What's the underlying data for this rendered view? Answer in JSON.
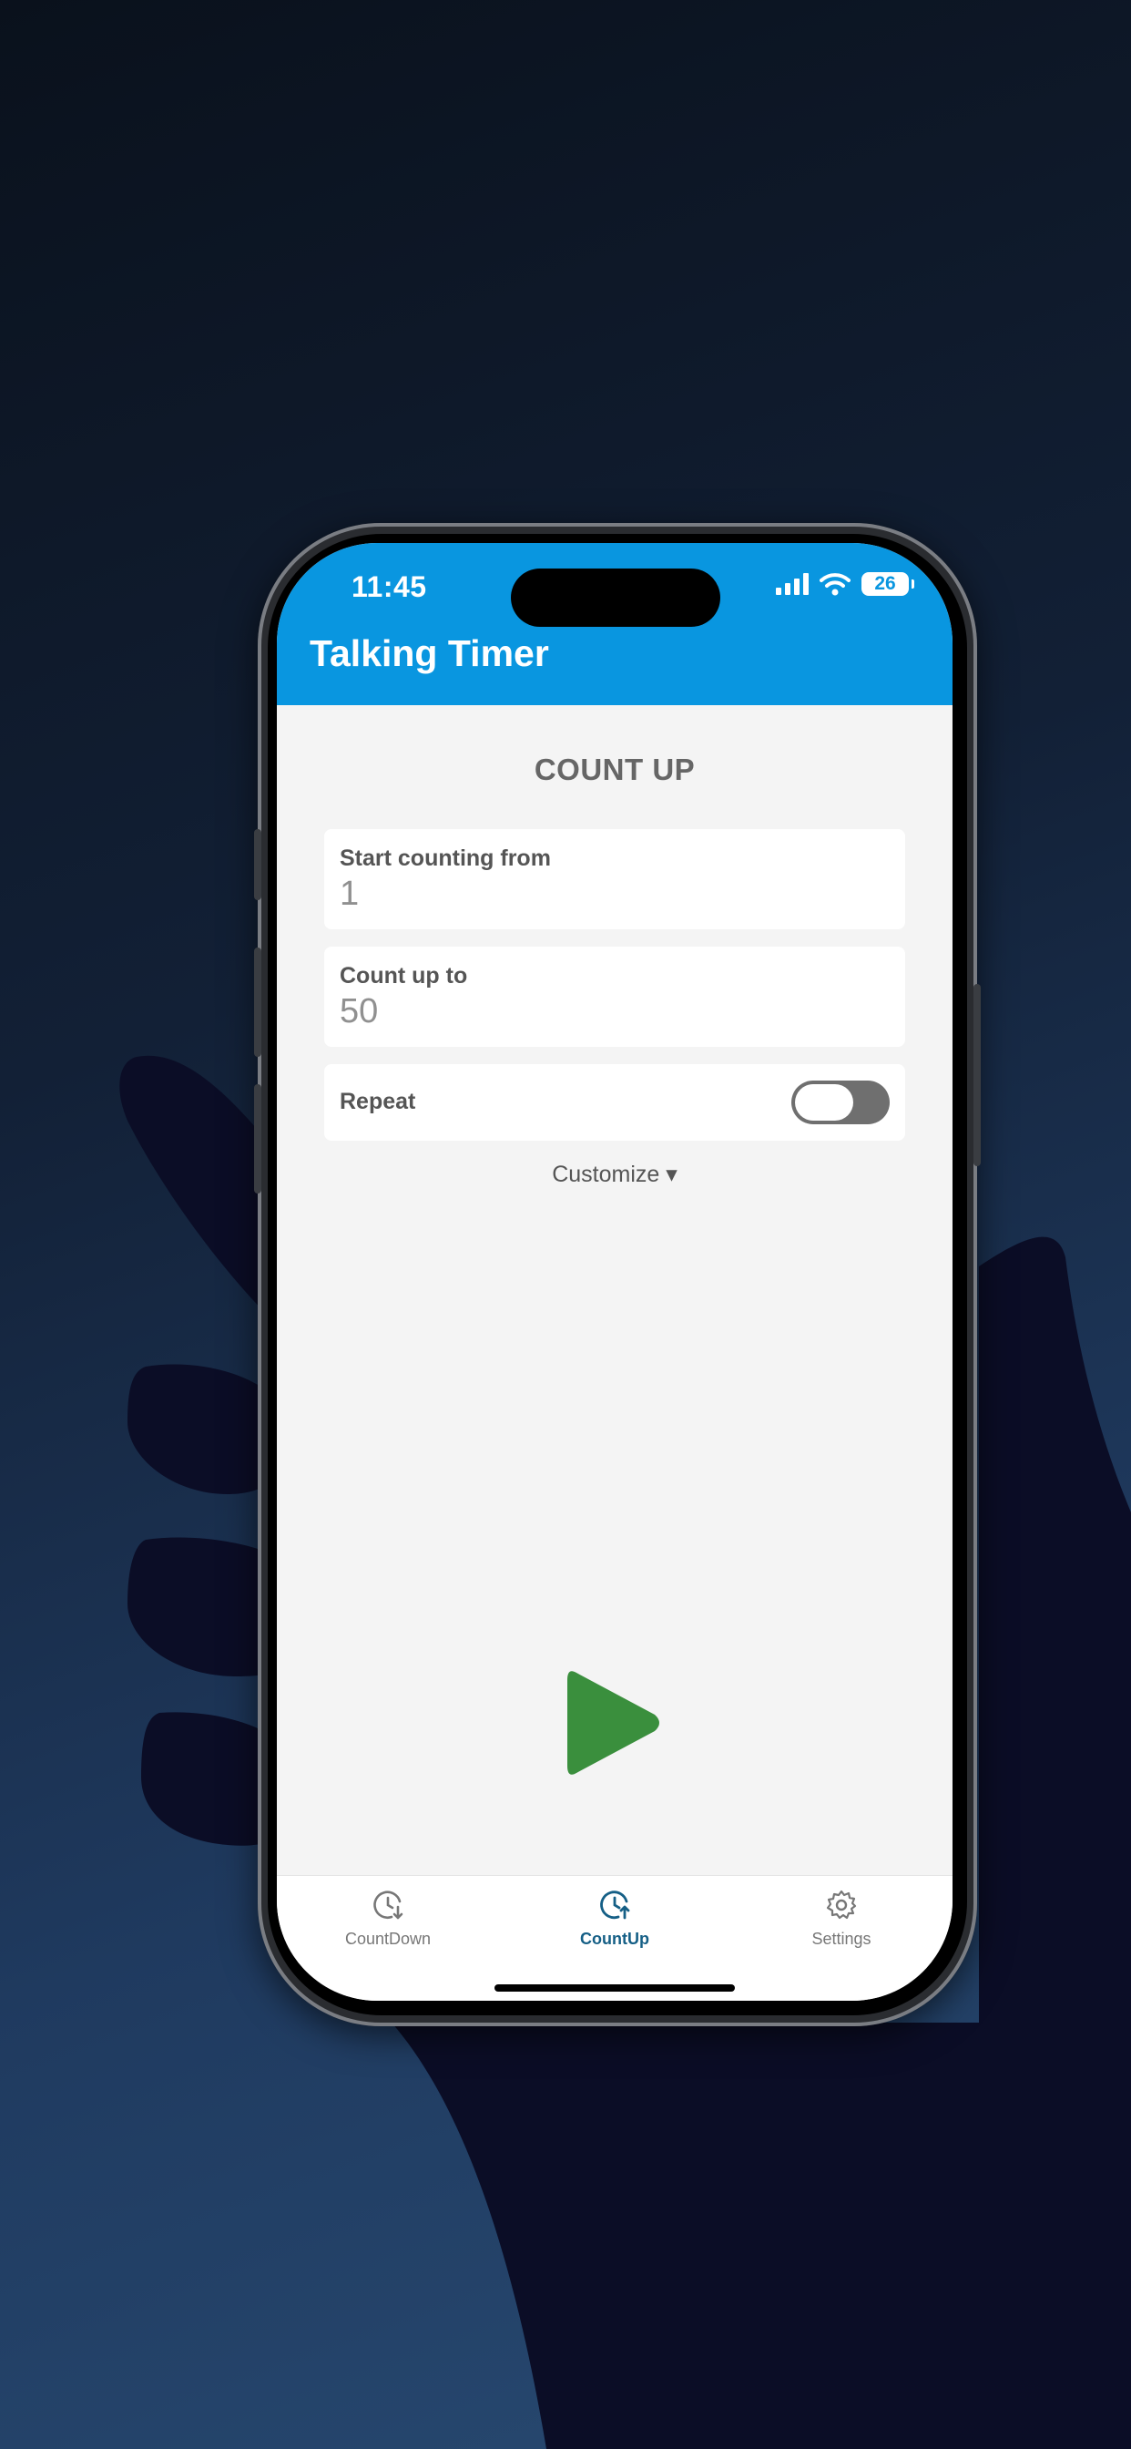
{
  "status_bar": {
    "time": "11:45",
    "battery": "26"
  },
  "header": {
    "title": "Talking Timer"
  },
  "main": {
    "section_title": "COUNT UP",
    "start_field": {
      "label": "Start counting from",
      "value": "1"
    },
    "end_field": {
      "label": "Count up to",
      "value": "50"
    },
    "repeat": {
      "label": "Repeat",
      "enabled": false
    },
    "customize_label": "Customize ▾"
  },
  "tabs": [
    {
      "label": "CountDown",
      "icon": "clock-down-icon",
      "active": false
    },
    {
      "label": "CountUp",
      "icon": "clock-up-icon",
      "active": true
    },
    {
      "label": "Settings",
      "icon": "gear-icon",
      "active": false
    }
  ],
  "colors": {
    "header": "#0996e0",
    "play": "#3a8f3d",
    "tab_active": "#155f86",
    "tab_inactive": "#777777"
  }
}
